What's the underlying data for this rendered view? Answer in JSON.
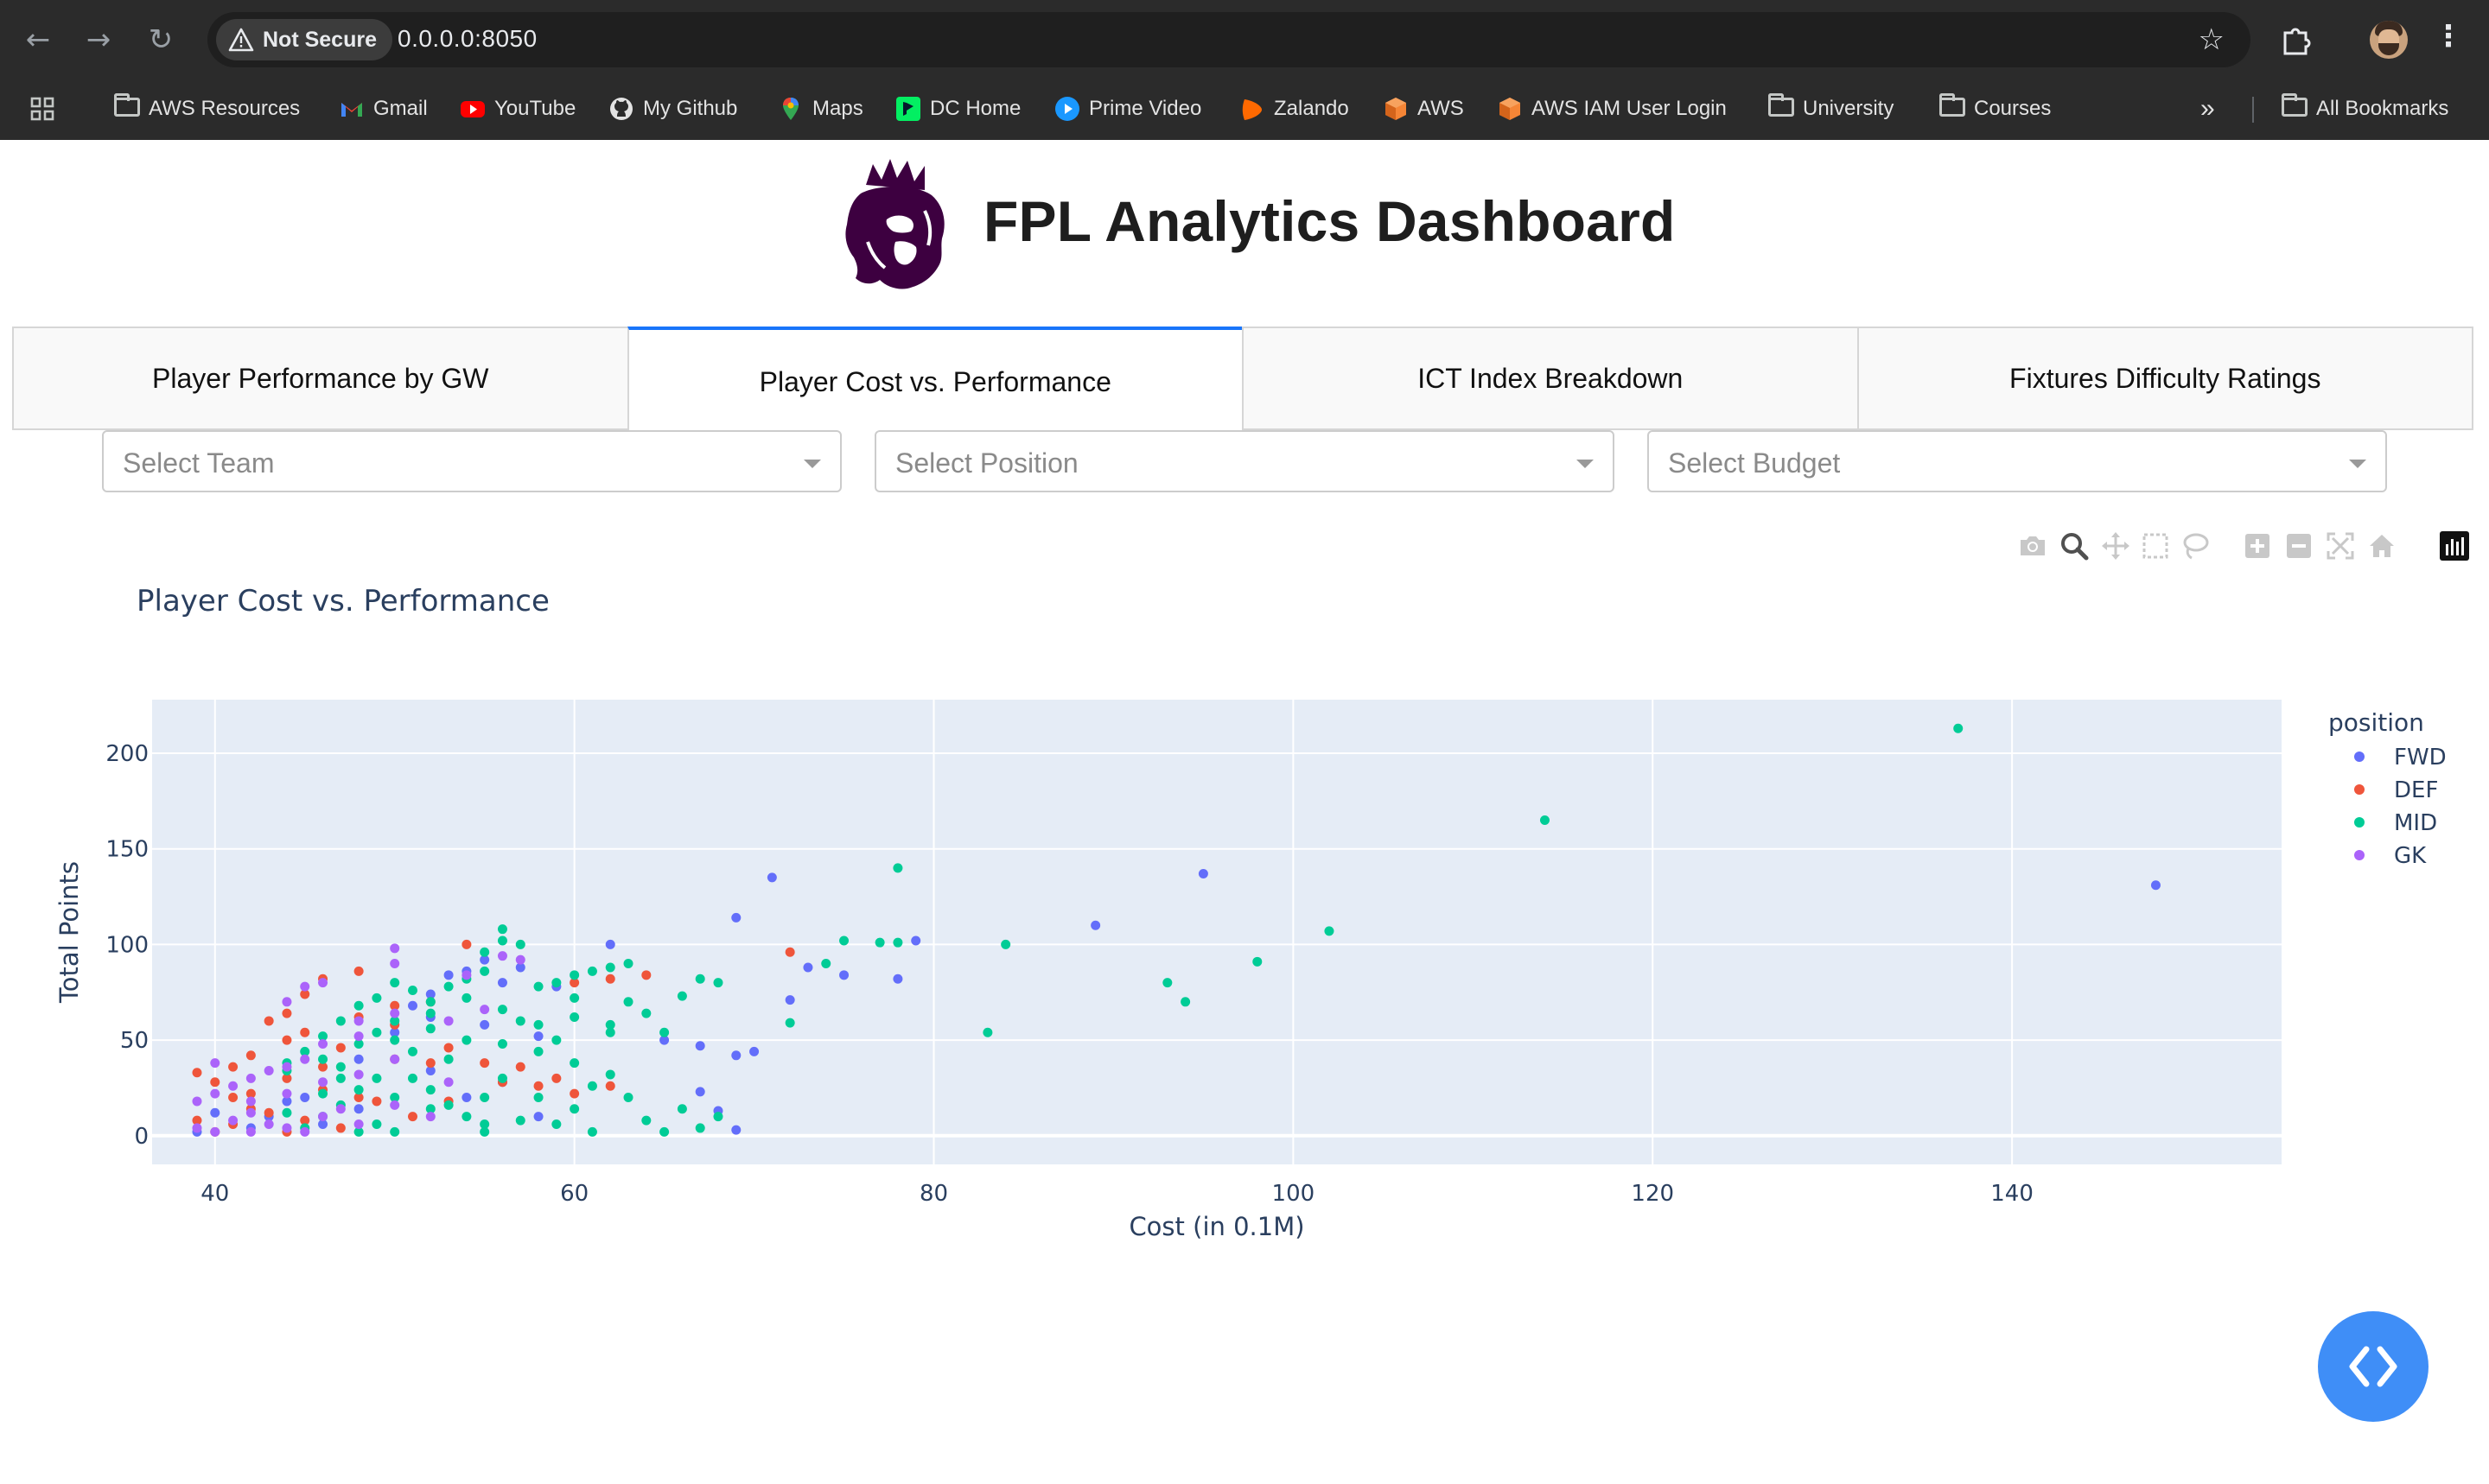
{
  "browser": {
    "security_label": "Not Secure",
    "url": "0.0.0.0:8050",
    "bookmarks": [
      {
        "label": "AWS Resources",
        "icon": "folder-icon"
      },
      {
        "label": "Gmail",
        "icon": "gmail-icon"
      },
      {
        "label": "YouTube",
        "icon": "youtube-icon"
      },
      {
        "label": "My Github",
        "icon": "github-icon"
      },
      {
        "label": "Maps",
        "icon": "maps-icon"
      },
      {
        "label": "DC Home",
        "icon": "datacamp-icon"
      },
      {
        "label": "Prime Video",
        "icon": "prime-video-icon"
      },
      {
        "label": "Zalando",
        "icon": "zalando-icon"
      },
      {
        "label": "AWS",
        "icon": "aws-icon"
      },
      {
        "label": "AWS IAM User Login",
        "icon": "aws-icon"
      },
      {
        "label": "University",
        "icon": "folder-icon"
      },
      {
        "label": "Courses",
        "icon": "folder-icon"
      }
    ],
    "more_bookmarks": "»",
    "all_bookmarks": "All Bookmarks"
  },
  "app": {
    "title": "FPL Analytics Dashboard",
    "tabs": [
      {
        "label": "Player Performance by GW",
        "active": false
      },
      {
        "label": "Player Cost vs. Performance",
        "active": true
      },
      {
        "label": "ICT Index Breakdown",
        "active": false
      },
      {
        "label": "Fixtures Difficulty Ratings",
        "active": false
      }
    ],
    "filters": {
      "team": {
        "placeholder": "Select Team"
      },
      "position": {
        "placeholder": "Select Position"
      },
      "budget": {
        "placeholder": "Select Budget"
      }
    }
  },
  "colors": {
    "FWD": "#636efa",
    "DEF": "#ef553b",
    "MID": "#00cc96",
    "GK": "#ab63fa",
    "plot_bg": "#e5ecf6",
    "accent": "#1975fa"
  },
  "chart_data": {
    "type": "scatter",
    "title": "Player Cost vs. Performance",
    "xlabel": "Cost (in 0.1M)",
    "ylabel": "Total Points",
    "xlim": [
      36.5,
      155
    ],
    "ylim": [
      -15,
      228
    ],
    "xticks": [
      40,
      60,
      80,
      100,
      120,
      140
    ],
    "yticks": [
      0,
      50,
      100,
      150,
      200
    ],
    "legend_title": "position",
    "legend_position": "right",
    "grid": true,
    "series": [
      {
        "name": "FWD",
        "points": [
          [
            71,
            135
          ],
          [
            95,
            137
          ],
          [
            148,
            131
          ],
          [
            89,
            110
          ],
          [
            79,
            102
          ],
          [
            69,
            114
          ],
          [
            75,
            84
          ],
          [
            78,
            82
          ],
          [
            73,
            88
          ],
          [
            72,
            71
          ],
          [
            65,
            50
          ],
          [
            67,
            47
          ],
          [
            70,
            44
          ],
          [
            69,
            42
          ],
          [
            67,
            23
          ],
          [
            68,
            13
          ],
          [
            69,
            3
          ],
          [
            62,
            100
          ],
          [
            59,
            78
          ],
          [
            58,
            52
          ],
          [
            57,
            88
          ],
          [
            56,
            80
          ],
          [
            55,
            92
          ],
          [
            54,
            86
          ],
          [
            53,
            84
          ],
          [
            52,
            74
          ],
          [
            51,
            68
          ],
          [
            50,
            54
          ],
          [
            48,
            40
          ],
          [
            55,
            58
          ],
          [
            52,
            62
          ],
          [
            58,
            10
          ],
          [
            56,
            28
          ],
          [
            54,
            20
          ],
          [
            52,
            34
          ],
          [
            48,
            14
          ],
          [
            46,
            6
          ],
          [
            45,
            20
          ],
          [
            44,
            18
          ],
          [
            43,
            10
          ],
          [
            42,
            4
          ],
          [
            40,
            12
          ],
          [
            39,
            2
          ]
        ]
      },
      {
        "name": "DEF",
        "points": [
          [
            72,
            96
          ],
          [
            62,
            82
          ],
          [
            60,
            80
          ],
          [
            64,
            84
          ],
          [
            54,
            100
          ],
          [
            52,
            70
          ],
          [
            50,
            68
          ],
          [
            48,
            86
          ],
          [
            48,
            62
          ],
          [
            46,
            82
          ],
          [
            45,
            74
          ],
          [
            44,
            64
          ],
          [
            43,
            60
          ],
          [
            45,
            54
          ],
          [
            44,
            50
          ],
          [
            42,
            42
          ],
          [
            41,
            36
          ],
          [
            39,
            33
          ],
          [
            40,
            28
          ],
          [
            42,
            22
          ],
          [
            41,
            20
          ],
          [
            44,
            30
          ],
          [
            46,
            36
          ],
          [
            47,
            46
          ],
          [
            48,
            20
          ],
          [
            50,
            40
          ],
          [
            52,
            38
          ],
          [
            53,
            46
          ],
          [
            55,
            38
          ],
          [
            56,
            28
          ],
          [
            58,
            26
          ],
          [
            59,
            30
          ],
          [
            60,
            22
          ],
          [
            62,
            26
          ],
          [
            45,
            8
          ],
          [
            43,
            12
          ],
          [
            41,
            6
          ],
          [
            40,
            2
          ],
          [
            39,
            8
          ],
          [
            42,
            14
          ],
          [
            46,
            24
          ],
          [
            49,
            18
          ],
          [
            51,
            10
          ],
          [
            47,
            4
          ],
          [
            44,
            2
          ],
          [
            50,
            58
          ],
          [
            53,
            18
          ],
          [
            57,
            36
          ]
        ]
      },
      {
        "name": "MID",
        "points": [
          [
            137,
            213
          ],
          [
            114,
            165
          ],
          [
            78,
            140
          ],
          [
            102,
            107
          ],
          [
            98,
            91
          ],
          [
            84,
            100
          ],
          [
            93,
            80
          ],
          [
            94,
            70
          ],
          [
            83,
            54
          ],
          [
            75,
            102
          ],
          [
            77,
            101
          ],
          [
            78,
            101
          ],
          [
            74,
            90
          ],
          [
            72,
            59
          ],
          [
            68,
            80
          ],
          [
            67,
            82
          ],
          [
            66,
            73
          ],
          [
            64,
            64
          ],
          [
            63,
            90
          ],
          [
            62,
            88
          ],
          [
            61,
            86
          ],
          [
            60,
            84
          ],
          [
            59,
            80
          ],
          [
            58,
            78
          ],
          [
            57,
            100
          ],
          [
            56,
            108
          ],
          [
            56,
            102
          ],
          [
            55,
            96
          ],
          [
            55,
            86
          ],
          [
            54,
            82
          ],
          [
            53,
            78
          ],
          [
            52,
            70
          ],
          [
            51,
            76
          ],
          [
            50,
            80
          ],
          [
            49,
            72
          ],
          [
            48,
            68
          ],
          [
            47,
            60
          ],
          [
            46,
            52
          ],
          [
            45,
            44
          ],
          [
            44,
            38
          ],
          [
            50,
            60
          ],
          [
            52,
            56
          ],
          [
            54,
            50
          ],
          [
            56,
            48
          ],
          [
            58,
            44
          ],
          [
            60,
            38
          ],
          [
            62,
            32
          ],
          [
            61,
            26
          ],
          [
            63,
            20
          ],
          [
            64,
            8
          ],
          [
            65,
            2
          ],
          [
            66,
            14
          ],
          [
            67,
            4
          ],
          [
            68,
            10
          ],
          [
            62,
            54
          ],
          [
            60,
            62
          ],
          [
            58,
            58
          ],
          [
            56,
            66
          ],
          [
            54,
            72
          ],
          [
            52,
            64
          ],
          [
            50,
            50
          ],
          [
            48,
            48
          ],
          [
            46,
            40
          ],
          [
            44,
            34
          ],
          [
            50,
            20
          ],
          [
            51,
            30
          ],
          [
            52,
            24
          ],
          [
            53,
            16
          ],
          [
            54,
            10
          ],
          [
            55,
            6
          ],
          [
            55,
            2
          ],
          [
            57,
            8
          ],
          [
            59,
            6
          ],
          [
            60,
            14
          ],
          [
            61,
            2
          ],
          [
            49,
            30
          ],
          [
            48,
            24
          ],
          [
            47,
            16
          ],
          [
            46,
            10
          ],
          [
            45,
            4
          ],
          [
            50,
            2
          ],
          [
            52,
            14
          ],
          [
            49,
            6
          ],
          [
            48,
            2
          ],
          [
            47,
            30
          ],
          [
            46,
            22
          ],
          [
            44,
            12
          ],
          [
            60,
            72
          ],
          [
            63,
            70
          ],
          [
            65,
            54
          ],
          [
            57,
            60
          ],
          [
            59,
            50
          ],
          [
            53,
            40
          ],
          [
            51,
            44
          ],
          [
            49,
            54
          ],
          [
            47,
            36
          ],
          [
            55,
            20
          ],
          [
            56,
            30
          ],
          [
            58,
            20
          ],
          [
            62,
            58
          ]
        ]
      },
      {
        "name": "GK",
        "points": [
          [
            50,
            98
          ],
          [
            50,
            90
          ],
          [
            46,
            80
          ],
          [
            45,
            78
          ],
          [
            44,
            70
          ],
          [
            54,
            84
          ],
          [
            55,
            66
          ],
          [
            53,
            60
          ],
          [
            50,
            64
          ],
          [
            48,
            60
          ],
          [
            48,
            52
          ],
          [
            46,
            48
          ],
          [
            45,
            40
          ],
          [
            44,
            36
          ],
          [
            43,
            34
          ],
          [
            42,
            30
          ],
          [
            41,
            26
          ],
          [
            40,
            22
          ],
          [
            40,
            38
          ],
          [
            39,
            18
          ],
          [
            41,
            8
          ],
          [
            42,
            12
          ],
          [
            43,
            6
          ],
          [
            44,
            4
          ],
          [
            45,
            2
          ],
          [
            46,
            10
          ],
          [
            47,
            14
          ],
          [
            48,
            6
          ],
          [
            50,
            16
          ],
          [
            52,
            10
          ],
          [
            40,
            2
          ],
          [
            39,
            4
          ],
          [
            42,
            2
          ],
          [
            57,
            92
          ],
          [
            56,
            94
          ],
          [
            50,
            40
          ],
          [
            46,
            28
          ],
          [
            44,
            22
          ],
          [
            42,
            18
          ],
          [
            48,
            32
          ],
          [
            53,
            28
          ]
        ]
      }
    ]
  }
}
